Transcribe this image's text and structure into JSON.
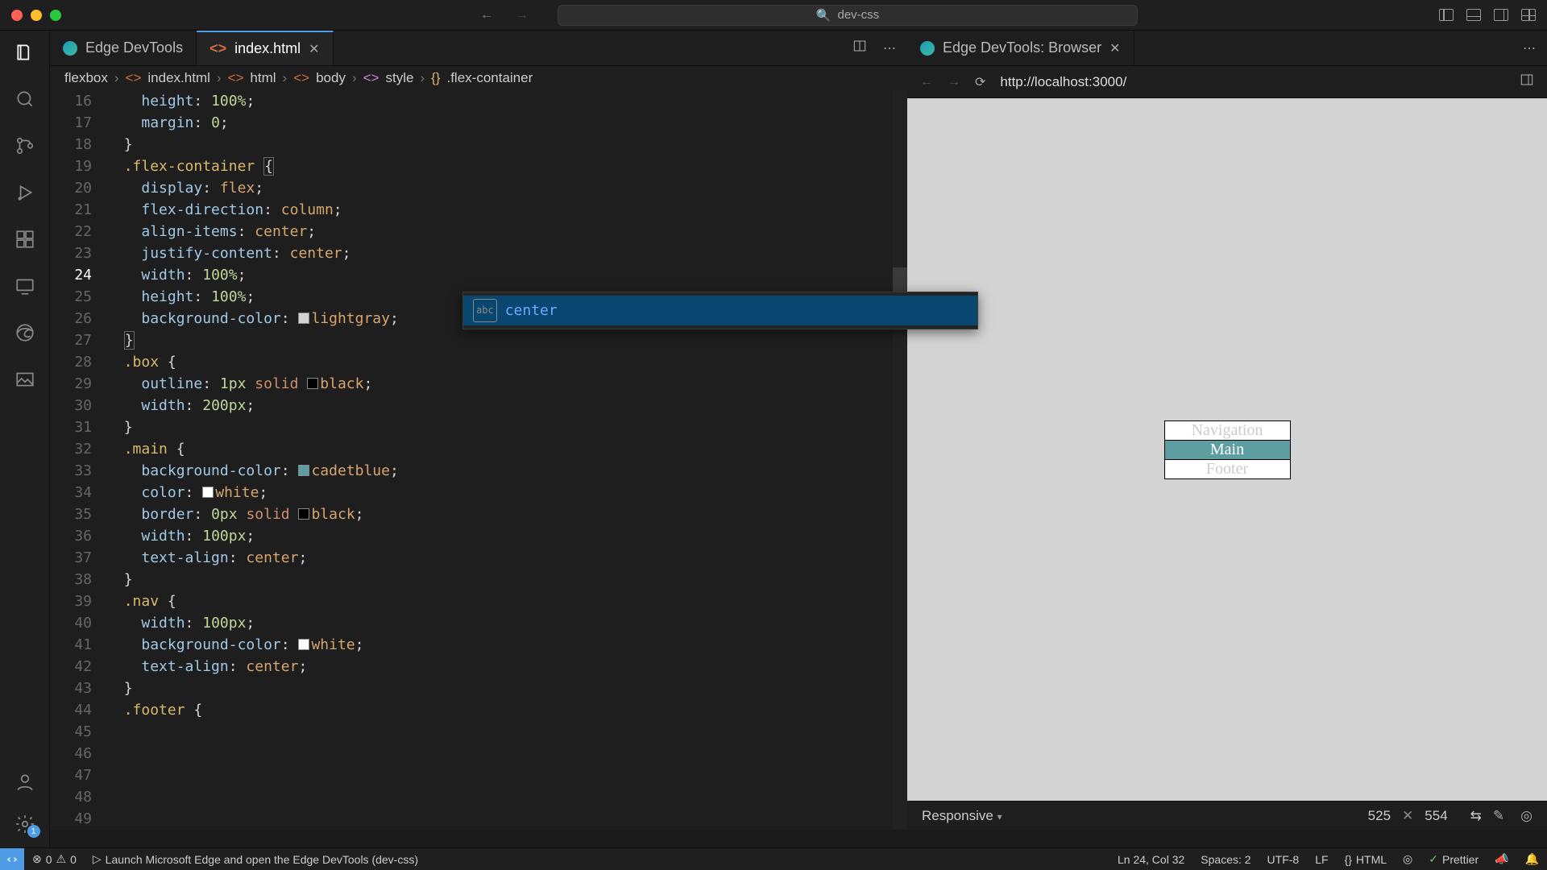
{
  "titlebar": {
    "project": "dev-css"
  },
  "tabs": {
    "left": [
      {
        "label": "Edge DevTools",
        "kind": "edge"
      },
      {
        "label": "index.html",
        "kind": "html",
        "active": true
      }
    ],
    "right": [
      {
        "label": "Edge DevTools: Browser",
        "kind": "edge"
      }
    ]
  },
  "breadcrumb": [
    "flexbox",
    "index.html",
    "html",
    "body",
    "style",
    ".flex-container"
  ],
  "gutter": {
    "start": 16,
    "end": 49,
    "active": 24
  },
  "code_lines": [
    [
      [
        "prop",
        "height"
      ],
      [
        "punct",
        ": "
      ],
      [
        "num",
        "100%"
      ],
      [
        "punct",
        ";"
      ]
    ],
    [
      [
        "prop",
        "margin"
      ],
      [
        "punct",
        ": "
      ],
      [
        "num",
        "0"
      ],
      [
        "punct",
        ";"
      ]
    ],
    [
      [
        "punct",
        "}"
      ]
    ],
    [],
    [
      [
        "sel",
        ".flex-container "
      ],
      [
        "brace",
        "{"
      ]
    ],
    [
      [
        "prop",
        "display"
      ],
      [
        "punct",
        ": "
      ],
      [
        "ident",
        "flex"
      ],
      [
        "punct",
        ";"
      ]
    ],
    [
      [
        "prop",
        "flex-direction"
      ],
      [
        "punct",
        ": "
      ],
      [
        "ident",
        "column"
      ],
      [
        "punct",
        ";"
      ]
    ],
    [
      [
        "prop",
        "align-items"
      ],
      [
        "punct",
        ": "
      ],
      [
        "ident",
        "center"
      ],
      [
        "punct",
        ";"
      ]
    ],
    [
      [
        "prop",
        "justify-content"
      ],
      [
        "punct",
        ": "
      ],
      [
        "ident",
        "center"
      ],
      [
        "punct",
        ";"
      ]
    ],
    [
      [
        "prop",
        "width"
      ],
      [
        "punct",
        ": "
      ],
      [
        "num",
        "100%"
      ],
      [
        "punct",
        ";"
      ]
    ],
    [
      [
        "prop",
        "height"
      ],
      [
        "punct",
        ": "
      ],
      [
        "num",
        "100%"
      ],
      [
        "punct",
        ";"
      ]
    ],
    [
      [
        "prop",
        "background-color"
      ],
      [
        "punct",
        ": "
      ],
      [
        "swatch",
        "#d3d3d3"
      ],
      [
        "ident",
        "lightgray"
      ],
      [
        "punct",
        ";"
      ]
    ],
    [
      [
        "brace",
        "}"
      ]
    ],
    [],
    [
      [
        "sel",
        ".box "
      ],
      [
        "punct",
        "{"
      ]
    ],
    [
      [
        "prop",
        "outline"
      ],
      [
        "punct",
        ": "
      ],
      [
        "num",
        "1px "
      ],
      [
        "kw",
        "solid "
      ],
      [
        "swatch",
        "#000"
      ],
      [
        "ident",
        "black"
      ],
      [
        "punct",
        ";"
      ]
    ],
    [
      [
        "prop",
        "width"
      ],
      [
        "punct",
        ": "
      ],
      [
        "num",
        "200px"
      ],
      [
        "punct",
        ";"
      ]
    ],
    [
      [
        "punct",
        "}"
      ]
    ],
    [],
    [
      [
        "sel",
        ".main "
      ],
      [
        "punct",
        "{"
      ]
    ],
    [
      [
        "prop",
        "background-color"
      ],
      [
        "punct",
        ": "
      ],
      [
        "swatch",
        "#5f9ea0"
      ],
      [
        "ident",
        "cadetblue"
      ],
      [
        "punct",
        ";"
      ]
    ],
    [
      [
        "prop",
        "color"
      ],
      [
        "punct",
        ": "
      ],
      [
        "swatch",
        "#fff"
      ],
      [
        "ident",
        "white"
      ],
      [
        "punct",
        ";"
      ]
    ],
    [
      [
        "prop",
        "border"
      ],
      [
        "punct",
        ": "
      ],
      [
        "num",
        "0px "
      ],
      [
        "kw",
        "solid "
      ],
      [
        "swatch",
        "#000"
      ],
      [
        "ident",
        "black"
      ],
      [
        "punct",
        ";"
      ]
    ],
    [
      [
        "prop",
        "width"
      ],
      [
        "punct",
        ": "
      ],
      [
        "num",
        "100px"
      ],
      [
        "punct",
        ";"
      ]
    ],
    [
      [
        "prop",
        "text-align"
      ],
      [
        "punct",
        ": "
      ],
      [
        "ident",
        "center"
      ],
      [
        "punct",
        ";"
      ]
    ],
    [
      [
        "punct",
        "}"
      ]
    ],
    [],
    [
      [
        "sel",
        ".nav "
      ],
      [
        "punct",
        "{"
      ]
    ],
    [
      [
        "prop",
        "width"
      ],
      [
        "punct",
        ": "
      ],
      [
        "num",
        "100px"
      ],
      [
        "punct",
        ";"
      ]
    ],
    [
      [
        "prop",
        "background-color"
      ],
      [
        "punct",
        ": "
      ],
      [
        "swatch",
        "#fff"
      ],
      [
        "ident",
        "white"
      ],
      [
        "punct",
        ";"
      ]
    ],
    [
      [
        "prop",
        "text-align"
      ],
      [
        "punct",
        ": "
      ],
      [
        "ident",
        "center"
      ],
      [
        "punct",
        ";"
      ]
    ],
    [
      [
        "punct",
        "}"
      ]
    ],
    [],
    [
      [
        "sel",
        ".footer "
      ],
      [
        "punct",
        "{"
      ]
    ]
  ],
  "code_indent": [
    2,
    2,
    1,
    0,
    1,
    2,
    2,
    2,
    2,
    2,
    2,
    2,
    1,
    0,
    1,
    2,
    2,
    1,
    0,
    1,
    2,
    2,
    2,
    2,
    2,
    1,
    0,
    1,
    2,
    2,
    2,
    1,
    0,
    1
  ],
  "suggest": {
    "label": "center"
  },
  "browser": {
    "url": "http://localhost:3000/",
    "boxes": {
      "nav": "Navigation",
      "main": "Main",
      "footer": "Footer"
    },
    "responsive": "Responsive",
    "w": "525",
    "h": "554"
  },
  "status": {
    "errors": "0",
    "warnings": "0",
    "launch": "Launch Microsoft Edge and open the Edge DevTools (dev-css)",
    "lncol": "Ln 24, Col 32",
    "spaces": "Spaces: 2",
    "encoding": "UTF-8",
    "eol": "LF",
    "lang": "HTML",
    "prettier": "Prettier",
    "gear_badge": "1"
  }
}
